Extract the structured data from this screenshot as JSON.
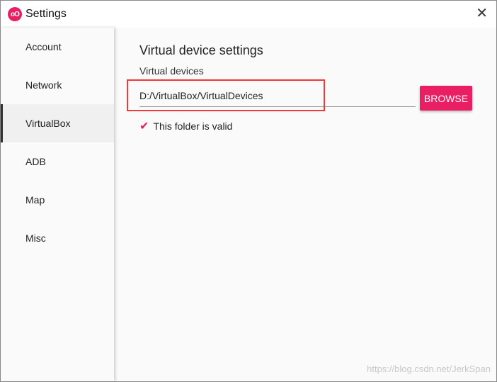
{
  "window": {
    "title": "Settings",
    "logo_text": "oO",
    "accent": "#e91e63"
  },
  "sidebar": {
    "items": [
      {
        "label": "Account"
      },
      {
        "label": "Network"
      },
      {
        "label": "VirtualBox",
        "active": true
      },
      {
        "label": "ADB"
      },
      {
        "label": "Map"
      },
      {
        "label": "Misc"
      }
    ]
  },
  "main": {
    "heading": "Virtual device settings",
    "field_label": "Virtual devices",
    "field_value": "D:/VirtualBox/VirtualDevices",
    "browse_label": "BROWSE",
    "valid_text": "This folder is valid"
  },
  "watermark": "https://blog.csdn.net/JerkSpan"
}
